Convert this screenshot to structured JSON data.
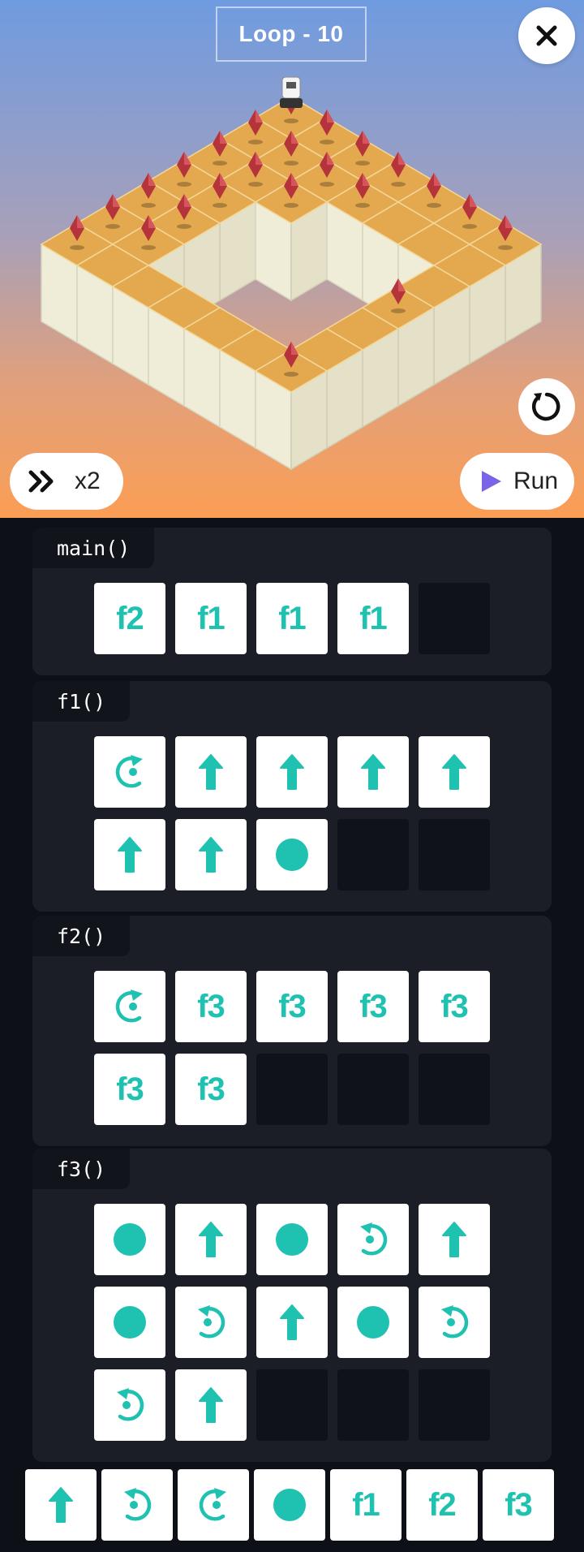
{
  "header": {
    "level_title": "Loop - 10"
  },
  "controls": {
    "close_icon": "close-icon",
    "reset_icon": "restart-icon",
    "speed_icon": "fast-forward-icon",
    "speed_label": "x2",
    "run_icon": "play-icon",
    "run_label": "Run"
  },
  "colors": {
    "accent": "#1fc2b1",
    "run_play": "#7a63e6",
    "tile_top": "#e4a94f",
    "tile_side": "#efedd8",
    "gem": "#b5343c"
  },
  "board": {
    "gems_visible": 23,
    "robot_icon": "robot-icon"
  },
  "functions": [
    {
      "name": "main()",
      "slots": [
        {
          "type": "call",
          "label": "f2"
        },
        {
          "type": "call",
          "label": "f1"
        },
        {
          "type": "call",
          "label": "f1"
        },
        {
          "type": "call",
          "label": "f1"
        },
        {
          "type": "empty"
        }
      ]
    },
    {
      "name": "f1()",
      "slots": [
        {
          "type": "icon",
          "icon": "turn-right-icon"
        },
        {
          "type": "icon",
          "icon": "forward-icon"
        },
        {
          "type": "icon",
          "icon": "forward-icon"
        },
        {
          "type": "icon",
          "icon": "forward-icon"
        },
        {
          "type": "icon",
          "icon": "forward-icon"
        },
        {
          "type": "icon",
          "icon": "forward-icon"
        },
        {
          "type": "icon",
          "icon": "forward-icon"
        },
        {
          "type": "icon",
          "icon": "collect-icon"
        },
        {
          "type": "empty"
        },
        {
          "type": "empty"
        }
      ]
    },
    {
      "name": "f2()",
      "slots": [
        {
          "type": "icon",
          "icon": "turn-right-icon"
        },
        {
          "type": "call",
          "label": "f3"
        },
        {
          "type": "call",
          "label": "f3"
        },
        {
          "type": "call",
          "label": "f3"
        },
        {
          "type": "call",
          "label": "f3"
        },
        {
          "type": "call",
          "label": "f3"
        },
        {
          "type": "call",
          "label": "f3"
        },
        {
          "type": "empty"
        },
        {
          "type": "empty"
        },
        {
          "type": "empty"
        }
      ]
    },
    {
      "name": "f3()",
      "slots": [
        {
          "type": "icon",
          "icon": "collect-icon"
        },
        {
          "type": "icon",
          "icon": "forward-icon"
        },
        {
          "type": "icon",
          "icon": "collect-icon"
        },
        {
          "type": "icon",
          "icon": "turn-left-icon"
        },
        {
          "type": "icon",
          "icon": "forward-icon"
        },
        {
          "type": "icon",
          "icon": "collect-icon"
        },
        {
          "type": "icon",
          "icon": "turn-left-icon"
        },
        {
          "type": "icon",
          "icon": "forward-icon"
        },
        {
          "type": "icon",
          "icon": "collect-icon"
        },
        {
          "type": "icon",
          "icon": "turn-left-icon"
        },
        {
          "type": "icon",
          "icon": "turn-left-icon"
        },
        {
          "type": "icon",
          "icon": "forward-icon"
        },
        {
          "type": "empty"
        },
        {
          "type": "empty"
        },
        {
          "type": "empty"
        }
      ]
    }
  ],
  "palette": [
    {
      "type": "icon",
      "icon": "forward-icon"
    },
    {
      "type": "icon",
      "icon": "turn-left-icon"
    },
    {
      "type": "icon",
      "icon": "turn-right-icon"
    },
    {
      "type": "icon",
      "icon": "collect-icon"
    },
    {
      "type": "call",
      "label": "f1"
    },
    {
      "type": "call",
      "label": "f2"
    },
    {
      "type": "call",
      "label": "f3"
    }
  ]
}
